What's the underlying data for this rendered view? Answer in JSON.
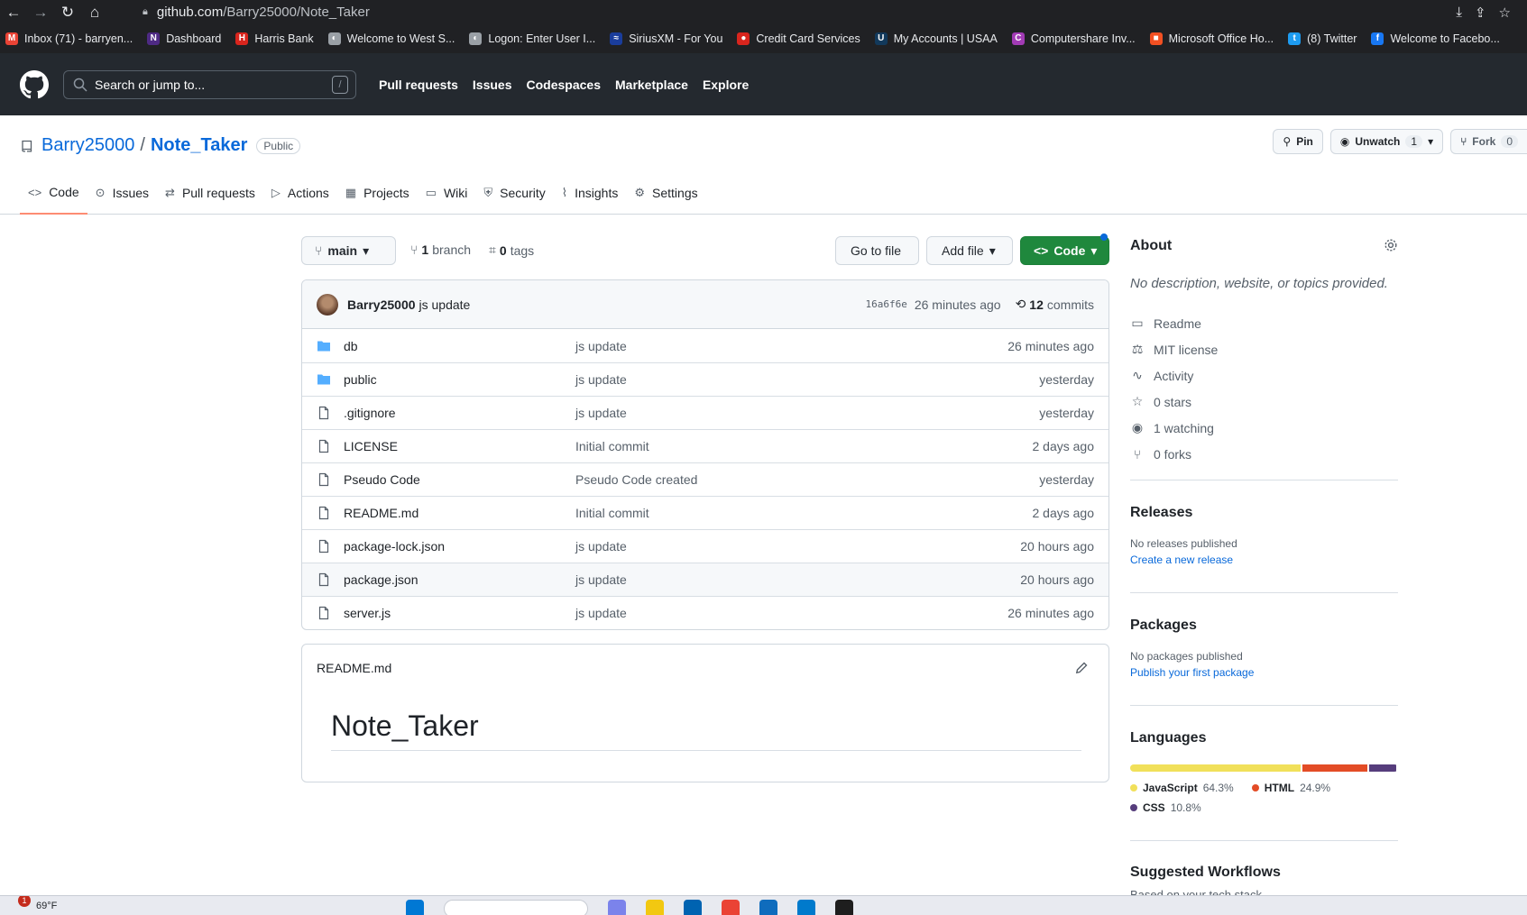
{
  "browser": {
    "url_host": "github.com",
    "url_path": "/Barry25000/Note_Taker",
    "bookmarks": [
      {
        "label": "Inbox (71) - barryen...",
        "color": "#ea4335",
        "glyph": "M"
      },
      {
        "label": "Dashboard",
        "color": "#4e2a84",
        "glyph": "N"
      },
      {
        "label": "Harris Bank",
        "color": "#d9251d",
        "glyph": "H"
      },
      {
        "label": "Welcome to West S...",
        "color": "#9aa0a6",
        "glyph": "◐"
      },
      {
        "label": "Logon: Enter User I...",
        "color": "#9aa0a6",
        "glyph": "◐"
      },
      {
        "label": "SiriusXM - For You",
        "color": "#1a3d9c",
        "glyph": "≈"
      },
      {
        "label": "Credit Card Services",
        "color": "#d9251d",
        "glyph": "●"
      },
      {
        "label": "My Accounts | USAA",
        "color": "#12395b",
        "glyph": "U"
      },
      {
        "label": "Computershare Inv...",
        "color": "#a23bb5",
        "glyph": "C"
      },
      {
        "label": "Microsoft Office Ho...",
        "color": "#f25022",
        "glyph": "■"
      },
      {
        "label": "(8) Twitter",
        "color": "#1d9bf0",
        "glyph": "t"
      },
      {
        "label": "Welcome to Facebo...",
        "color": "#1877f2",
        "glyph": "f"
      }
    ]
  },
  "header": {
    "search_placeholder": "Search or jump to...",
    "slash_key": "/",
    "nav": [
      "Pull requests",
      "Issues",
      "Codespaces",
      "Marketplace",
      "Explore"
    ]
  },
  "repo": {
    "owner": "Barry25000",
    "separator": "/",
    "name": "Note_Taker",
    "visibility": "Public",
    "pin_label": "Pin",
    "unwatch_label": "Unwatch",
    "watch_count": "1",
    "fork_label": "Fork",
    "fork_count": "0",
    "tabs": [
      "Code",
      "Issues",
      "Pull requests",
      "Actions",
      "Projects",
      "Wiki",
      "Security",
      "Insights",
      "Settings"
    ]
  },
  "toolbar": {
    "branch": "main",
    "branch_count": "1",
    "branch_word": "branch",
    "tag_count": "0",
    "tag_word": "tags",
    "go_to_file": "Go to file",
    "add_file": "Add file",
    "code": "Code"
  },
  "commit": {
    "author": "Barry25000",
    "message": "js update",
    "sha": "16a6f6e",
    "age": "26 minutes ago",
    "count": "12",
    "count_word": "commits"
  },
  "files": [
    {
      "type": "dir",
      "name": "db",
      "message": "js update",
      "age": "26 minutes ago"
    },
    {
      "type": "dir",
      "name": "public",
      "message": "js update",
      "age": "yesterday"
    },
    {
      "type": "file",
      "name": ".gitignore",
      "message": "js update",
      "age": "yesterday"
    },
    {
      "type": "file",
      "name": "LICENSE",
      "message": "Initial commit",
      "age": "2 days ago"
    },
    {
      "type": "file",
      "name": "Pseudo Code",
      "message": "Pseudo Code created",
      "age": "yesterday"
    },
    {
      "type": "file",
      "name": "README.md",
      "message": "Initial commit",
      "age": "2 days ago"
    },
    {
      "type": "file",
      "name": "package-lock.json",
      "message": "js update",
      "age": "20 hours ago"
    },
    {
      "type": "file",
      "name": "package.json",
      "message": "js update",
      "age": "20 hours ago"
    },
    {
      "type": "file",
      "name": "server.js",
      "message": "js update",
      "age": "26 minutes ago"
    }
  ],
  "readme": {
    "filename": "README.md",
    "heading": "Note_Taker"
  },
  "about": {
    "title": "About",
    "description": "No description, website, or topics provided.",
    "items": [
      "Readme",
      "MIT license",
      "Activity",
      "0 stars",
      "1 watching",
      "0 forks"
    ]
  },
  "releases": {
    "title": "Releases",
    "status": "No releases published",
    "link": "Create a new release"
  },
  "packages": {
    "title": "Packages",
    "status": "No packages published",
    "link": "Publish your first package"
  },
  "languages": {
    "title": "Languages",
    "items": [
      {
        "name": "JavaScript",
        "percent": "64.3%",
        "share": 64.3,
        "color": "#f1e05a"
      },
      {
        "name": "HTML",
        "percent": "24.9%",
        "share": 24.9,
        "color": "#e34c26"
      },
      {
        "name": "CSS",
        "percent": "10.8%",
        "share": 10.8,
        "color": "#563d7c"
      }
    ]
  },
  "suggested": {
    "title": "Suggested Workflows",
    "subtitle": "Based on your tech stack"
  },
  "taskbar": {
    "temperature": "69°F",
    "notification_count": "1"
  },
  "colors": {
    "accent": "#0969da",
    "green": "#1f883d",
    "tab_underline": "#fd8c73",
    "header_bg": "#24292f"
  }
}
